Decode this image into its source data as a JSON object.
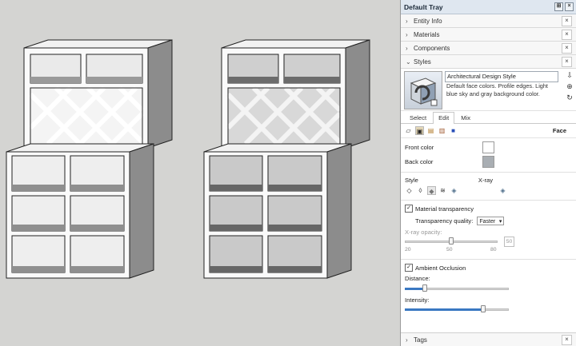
{
  "tray": {
    "title": "Default Tray",
    "pin_label": "⊞",
    "close_label": "×"
  },
  "panels": {
    "entity_info": "Entity Info",
    "materials": "Materials",
    "components": "Components",
    "styles": "Styles",
    "tags": "Tags",
    "collapsed_chevron": "›",
    "expanded_chevron": "⌄",
    "close_glyph": "×"
  },
  "styles_panel": {
    "style_name": "Architectural Design Style",
    "description": "Default face colors. Profile edges. Light blue sky and gray background color.",
    "tabs": [
      "Select",
      "Edit",
      "Mix"
    ],
    "active_tab": "Edit",
    "section_title": "Face",
    "front_color_label": "Front color",
    "back_color_label": "Back color",
    "front_color": "#ffffff",
    "back_color": "#a9aeb3",
    "style_label": "Style",
    "xray_label": "X-ray",
    "material_transparency_label": "Material transparency",
    "material_transparency_checked": true,
    "transparency_quality_label": "Transparency quality:",
    "transparency_quality_value": "Faster",
    "xray_opacity_label": "X-ray opacity:",
    "xray_opacity_value": "50",
    "xray_opacity_ticks": [
      "20",
      "50",
      "80"
    ],
    "xray_opacity_level": 0.5,
    "ambient_occlusion_label": "Ambient Occlusion",
    "ambient_occlusion_checked": true,
    "distance_label": "Distance:",
    "distance_level": 0.18,
    "intensity_label": "Intensity:",
    "intensity_level": 0.77,
    "check_glyph": "✓"
  },
  "colors": {
    "accent": "#3a78c2",
    "viewport_bg": "#d4d4d2"
  }
}
